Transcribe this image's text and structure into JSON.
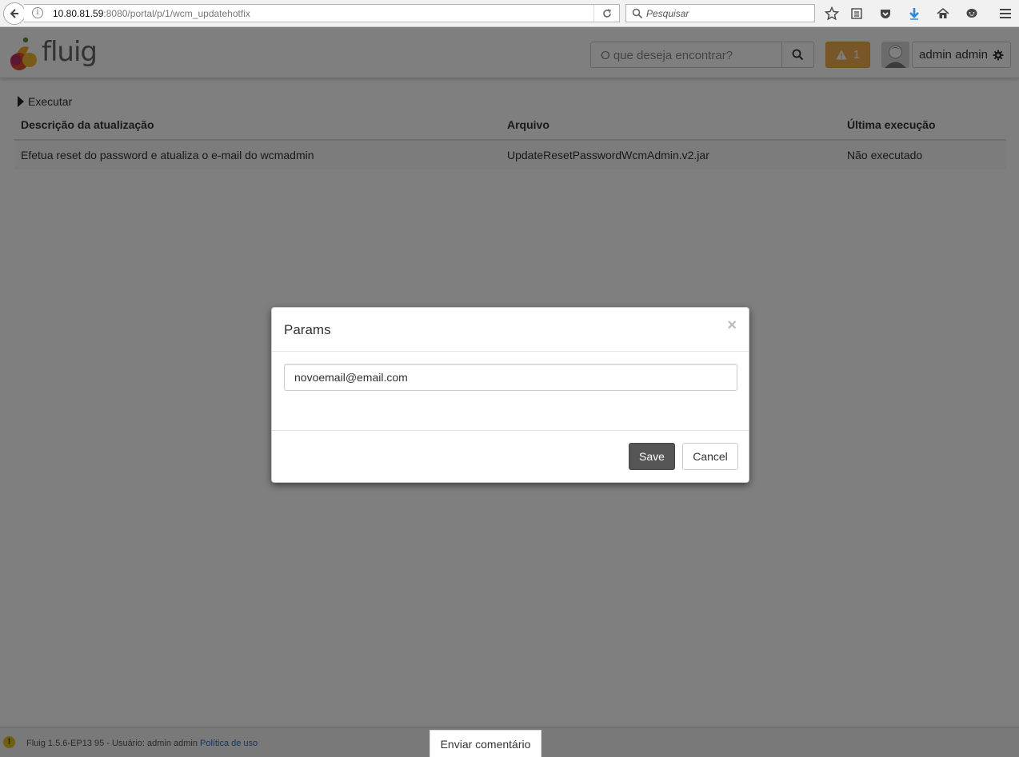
{
  "browser": {
    "url_host": "10.80.81.59",
    "url_rest": ":8080/portal/p/1/wcm_updatehotfix",
    "info_glyph": "i",
    "search_placeholder": "Pesquisar"
  },
  "header": {
    "logo_text": "fluig",
    "search_placeholder": "O que deseja encontrar?",
    "notification_count": "1",
    "user_label": "admin admin"
  },
  "main": {
    "execute_label": "Executar",
    "table": {
      "columns": [
        "Descrição da atualização",
        "Arquivo",
        "Última execução"
      ],
      "rows": [
        [
          "Efetua reset do password e atualiza o e-mail do wcmadmin",
          "UpdateResetPasswordWcmAdmin.v2.jar",
          "Não executado"
        ]
      ]
    }
  },
  "modal": {
    "title": "Params",
    "close_label": "×",
    "input_value": "novoemail@email.com",
    "save_label": "Save",
    "cancel_label": "Cancel"
  },
  "footer": {
    "warn_glyph": "!",
    "version_text": "Fluig 1.5.6-EP13 95 - Usuário: admin admin",
    "policy_link": "Política de uso",
    "feedback_label": "Enviar comentário"
  },
  "colors": {
    "warning": "#f0ad4e",
    "save_button": "#555555",
    "link": "#2a6ab8"
  }
}
